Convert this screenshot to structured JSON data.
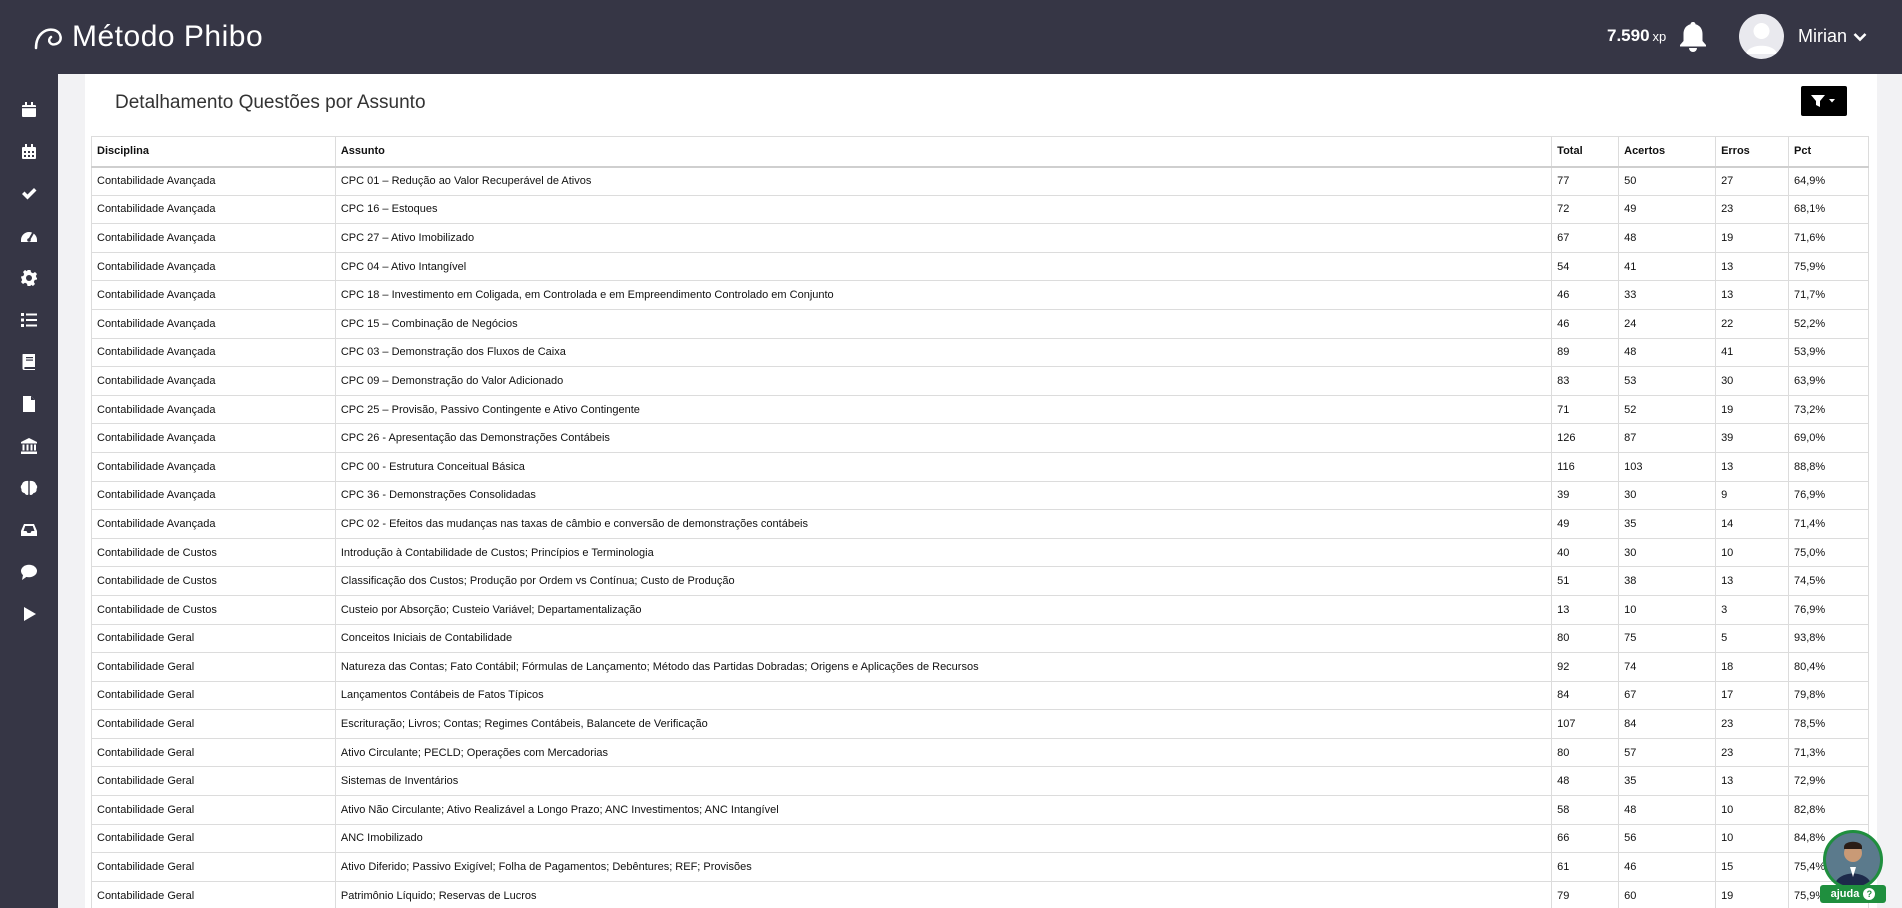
{
  "header": {
    "logo_text_light": "Método Phi",
    "logo_text_bold": "bo",
    "xp_value": "7.590",
    "xp_unit": "xp",
    "user_name": "Mirian"
  },
  "sidebar": {
    "icons": [
      "calendar-icon",
      "calendar-grid-icon",
      "check-icon",
      "dashboard-gauge-icon",
      "gear-icon",
      "list-icon",
      "book-icon",
      "file-icon",
      "bank-icon",
      "brain-icon",
      "inbox-icon",
      "comment-icon",
      "play-icon"
    ]
  },
  "main": {
    "title": "Detalhamento Questões por Assunto",
    "table": {
      "headers": [
        "Disciplina",
        "Assunto",
        "Total",
        "Acertos",
        "Erros",
        "Pct"
      ],
      "rows": [
        [
          "Contabilidade Avançada",
          "CPC 01 – Redução ao Valor Recuperável de Ativos",
          "77",
          "50",
          "27",
          "64,9%"
        ],
        [
          "Contabilidade Avançada",
          "CPC 16 – Estoques",
          "72",
          "49",
          "23",
          "68,1%"
        ],
        [
          "Contabilidade Avançada",
          "CPC 27 – Ativo Imobilizado",
          "67",
          "48",
          "19",
          "71,6%"
        ],
        [
          "Contabilidade Avançada",
          "CPC 04 – Ativo Intangível",
          "54",
          "41",
          "13",
          "75,9%"
        ],
        [
          "Contabilidade Avançada",
          "CPC 18 – Investimento em Coligada, em Controlada e em Empreendimento Controlado em Conjunto",
          "46",
          "33",
          "13",
          "71,7%"
        ],
        [
          "Contabilidade Avançada",
          "CPC 15 – Combinação de Negócios",
          "46",
          "24",
          "22",
          "52,2%"
        ],
        [
          "Contabilidade Avançada",
          "CPC 03 – Demonstração dos Fluxos de Caixa",
          "89",
          "48",
          "41",
          "53,9%"
        ],
        [
          "Contabilidade Avançada",
          "CPC 09 – Demonstração do Valor Adicionado",
          "83",
          "53",
          "30",
          "63,9%"
        ],
        [
          "Contabilidade Avançada",
          "CPC 25 – Provisão, Passivo Contingente e Ativo Contingente",
          "71",
          "52",
          "19",
          "73,2%"
        ],
        [
          "Contabilidade Avançada",
          "CPC 26 - Apresentação das Demonstrações Contábeis",
          "126",
          "87",
          "39",
          "69,0%"
        ],
        [
          "Contabilidade Avançada",
          "CPC 00 - Estrutura Conceitual Básica",
          "116",
          "103",
          "13",
          "88,8%"
        ],
        [
          "Contabilidade Avançada",
          "CPC 36 - Demonstrações Consolidadas",
          "39",
          "30",
          "9",
          "76,9%"
        ],
        [
          "Contabilidade Avançada",
          "CPC 02 - Efeitos das mudanças nas taxas de câmbio e conversão de demonstrações contábeis",
          "49",
          "35",
          "14",
          "71,4%"
        ],
        [
          "Contabilidade de Custos",
          "Introdução à Contabilidade de Custos; Princípios e Terminologia",
          "40",
          "30",
          "10",
          "75,0%"
        ],
        [
          "Contabilidade de Custos",
          "Classificação dos Custos; Produção por Ordem vs Contínua; Custo de Produção",
          "51",
          "38",
          "13",
          "74,5%"
        ],
        [
          "Contabilidade de Custos",
          "Custeio por Absorção; Custeio Variável; Departamentalização",
          "13",
          "10",
          "3",
          "76,9%"
        ],
        [
          "Contabilidade Geral",
          "Conceitos Iniciais de Contabilidade",
          "80",
          "75",
          "5",
          "93,8%"
        ],
        [
          "Contabilidade Geral",
          "Natureza das Contas; Fato Contábil; Fórmulas de Lançamento; Método das Partidas Dobradas; Origens e Aplicações de Recursos",
          "92",
          "74",
          "18",
          "80,4%"
        ],
        [
          "Contabilidade Geral",
          "Lançamentos Contábeis de Fatos Típicos",
          "84",
          "67",
          "17",
          "79,8%"
        ],
        [
          "Contabilidade Geral",
          "Escrituração; Livros; Contas; Regimes Contábeis, Balancete de Verificação",
          "107",
          "84",
          "23",
          "78,5%"
        ],
        [
          "Contabilidade Geral",
          "Ativo Circulante; PECLD; Operações com Mercadorias",
          "80",
          "57",
          "23",
          "71,3%"
        ],
        [
          "Contabilidade Geral",
          "Sistemas de Inventários",
          "48",
          "35",
          "13",
          "72,9%"
        ],
        [
          "Contabilidade Geral",
          "Ativo Não Circulante; Ativo Realizável a Longo Prazo; ANC Investimentos; ANC Intangível",
          "58",
          "48",
          "10",
          "82,8%"
        ],
        [
          "Contabilidade Geral",
          "ANC Imobilizado",
          "66",
          "56",
          "10",
          "84,8%"
        ],
        [
          "Contabilidade Geral",
          "Ativo Diferido; Passivo Exigível; Folha de Pagamentos; Debêntures; REF; Provisões",
          "61",
          "46",
          "15",
          "75,4%"
        ],
        [
          "Contabilidade Geral",
          "Patrimônio Líquido; Reservas de Lucros",
          "79",
          "60",
          "19",
          "75,9%"
        ]
      ]
    }
  },
  "help": {
    "label": "ajuda",
    "mark": "?"
  },
  "colors": {
    "dark_bar": "#363645",
    "help_green": "#1f8f3e"
  }
}
